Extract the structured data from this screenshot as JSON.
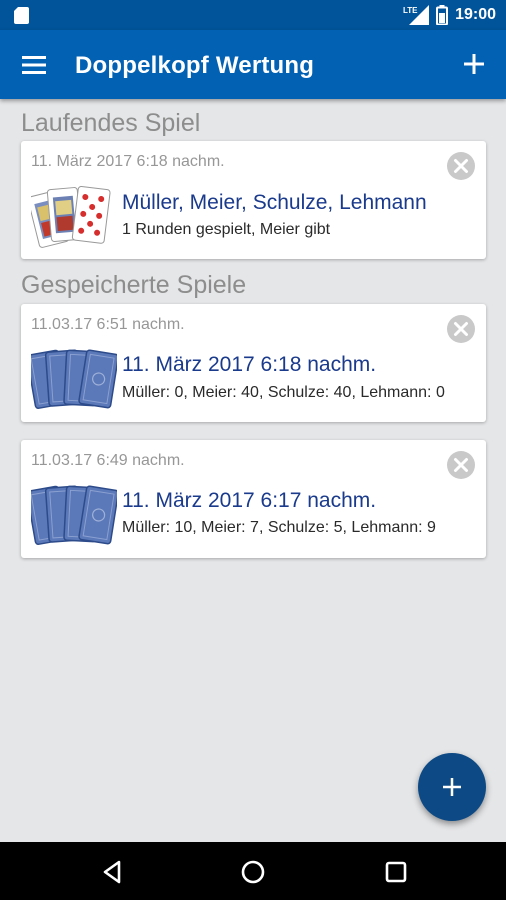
{
  "status_bar": {
    "time": "19:00",
    "network": "LTE",
    "icons": [
      "sd-card-icon",
      "lte-signal-icon",
      "battery-icon"
    ]
  },
  "app_bar": {
    "title": "Doppelkopf Wertung",
    "icons": [
      "menu-icon",
      "add-icon"
    ]
  },
  "running_section": {
    "title": "Laufendes Spiel",
    "game": {
      "date": "11. März 2017 6:18 nachm.",
      "players": "Müller, Meier, Schulze, Lehmann",
      "info": "1 Runden gespielt, Meier gibt",
      "thumbnail": "playing-cards-face-icon"
    }
  },
  "saved_section": {
    "title": "Gespeicherte Spiele",
    "games": [
      {
        "date": "11.03.17 6:51 nachm.",
        "title": "11. März 2017 6:18 nachm.",
        "scores": "Müller: 0, Meier: 40, Schulze: 40, Lehmann: 0",
        "thumbnail": "card-backs-icon"
      },
      {
        "date": "11.03.17 6:49 nachm.",
        "title": "11. März 2017 6:17 nachm.",
        "scores": "Müller: 10, Meier: 7, Schulze: 5, Lehmann: 9",
        "thumbnail": "card-backs-icon"
      }
    ]
  },
  "fab": {
    "icon": "add-icon"
  },
  "nav_bar": {
    "icons": [
      "back-icon",
      "home-icon",
      "recents-icon"
    ]
  },
  "colors": {
    "app_bar": "#0261b3",
    "status_bar": "#01539a",
    "background": "#e5e6e8",
    "fab": "#0d4a85",
    "title_text": "#1a3a8c",
    "card_back": "#5b78b8"
  }
}
